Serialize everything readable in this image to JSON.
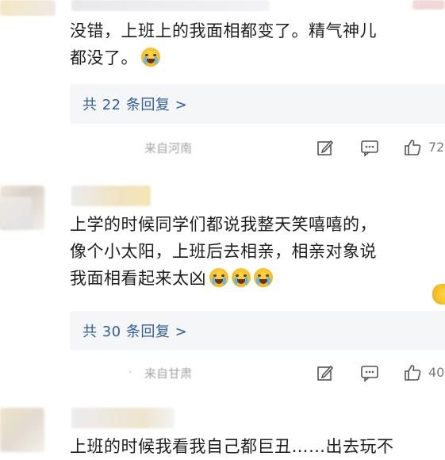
{
  "comments": [
    {
      "text_lines": [
        "没错，上班上的我面相都变了。精气神儿",
        "都没了。"
      ],
      "emoji_count": 1,
      "reply_label": "共 22 条回复 >",
      "location": "来自河南",
      "like_count": "72"
    },
    {
      "text_lines": [
        "上学的时候同学们都说我整天笑嘻嘻的，",
        "像个小太阳，上班后去相亲，相亲对象说",
        "我面相看起来太凶"
      ],
      "emoji_count": 3,
      "reply_label": "共 30 条回复 >",
      "location": "来自甘肃",
      "like_count": "40"
    },
    {
      "text_lines": [
        "上班的时候我看我自己都巨丑……出去玩不"
      ],
      "emoji_count": 0
    }
  ],
  "icons": {
    "edit": "edit-icon",
    "comment": "comment-icon",
    "like": "thumbs-up-icon"
  },
  "colors": {
    "reply_link": "#2f5d9d",
    "reply_bg": "#f5f6f8",
    "meta_text": "#a3a3a3"
  }
}
